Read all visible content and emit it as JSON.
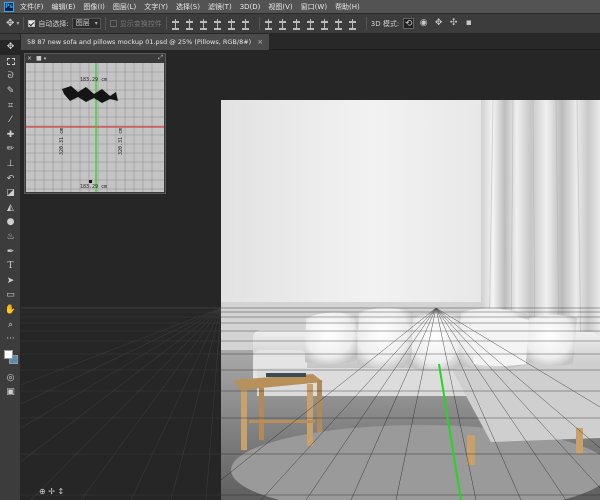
{
  "menubar": {
    "logo": "Ps",
    "items": [
      "文件(F)",
      "编辑(E)",
      "图像(I)",
      "图层(L)",
      "文字(Y)",
      "选择(S)",
      "滤镜(T)",
      "3D(D)",
      "视图(V)",
      "窗口(W)",
      "帮助(H)"
    ]
  },
  "options": {
    "auto_select_label": "自动选择:",
    "auto_select_value": "图层",
    "show_transform_label": "显示变换控件",
    "mode_3d_label": "3D 模式:"
  },
  "document": {
    "tab_title": "58 87 new sofa and pillows mockup 01.psd @ 25% (Pillows, RGB/8#)",
    "close_label": "×"
  },
  "secondary_view": {
    "dimension_top": "183.29 cm",
    "dimension_bottom": "183.29 cm",
    "dimension_left": "320.31 cm",
    "dimension_right": "320.31 cm"
  },
  "colors": {
    "ui_dark": "#282828",
    "panel": "#3c3c3c",
    "menubar": "#535353",
    "grid_green": "#22d622",
    "grid_red": "#e52222",
    "ps_blue": "#31a8ff"
  },
  "tools": [
    "move-icon",
    "marquee-icon",
    "lasso-icon",
    "quick-select-icon",
    "crop-icon",
    "eyedropper-icon",
    "healing-icon",
    "brush-icon",
    "stamp-icon",
    "history-brush-icon",
    "eraser-icon",
    "paint-bucket-icon",
    "blur-icon",
    "dodge-icon",
    "pen-icon",
    "type-icon",
    "path-select-icon",
    "shape-icon",
    "hand-icon",
    "zoom-icon",
    "more-tools-icon"
  ]
}
